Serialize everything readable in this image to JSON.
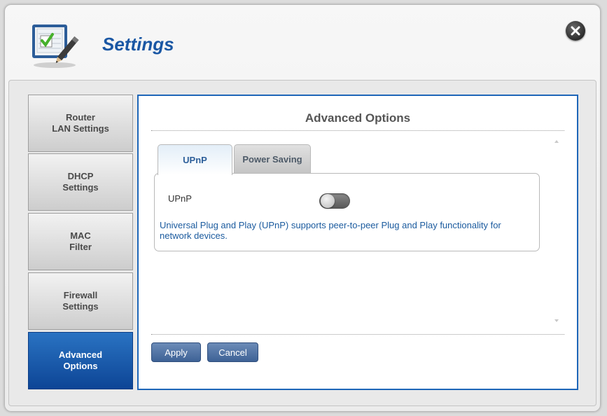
{
  "header": {
    "title": "Settings",
    "icon": "checklist-pencil-icon"
  },
  "close": {
    "icon": "close-icon"
  },
  "sidebar": {
    "items": [
      {
        "line1": "Router",
        "line2": "LAN Settings"
      },
      {
        "line1": "DHCP",
        "line2": "Settings"
      },
      {
        "line1": "MAC",
        "line2": "Filter"
      },
      {
        "line1": "Firewall",
        "line2": "Settings"
      },
      {
        "line1": "Advanced",
        "line2": "Options",
        "active": true
      }
    ]
  },
  "main": {
    "title": "Advanced Options",
    "tabs": [
      {
        "label": "UPnP",
        "active": true
      },
      {
        "label": "Power Saving",
        "active": false
      }
    ],
    "upnp": {
      "label": "UPnP",
      "toggle_state": "off",
      "description": "Universal Plug and Play (UPnP) supports peer-to-peer Plug and Play functionality for network devices."
    },
    "buttons": {
      "apply": "Apply",
      "cancel": "Cancel"
    }
  },
  "colors": {
    "accent": "#1e66b8",
    "title": "#1a57a4",
    "active_nav": "#0d4596"
  }
}
